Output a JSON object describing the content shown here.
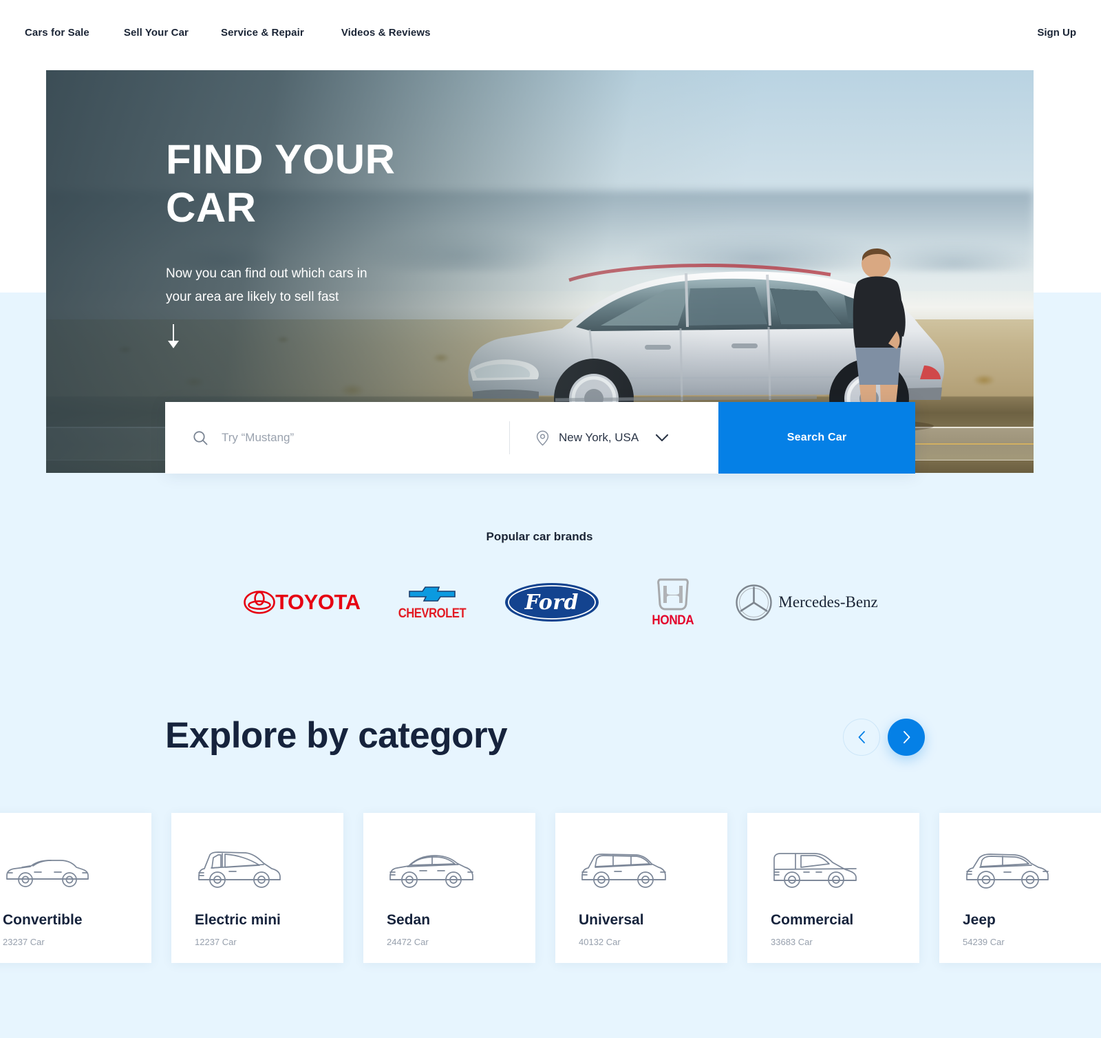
{
  "nav": {
    "links": [
      {
        "label": "Cars for Sale"
      },
      {
        "label": "Sell Your Car"
      },
      {
        "label": "Service & Repair"
      },
      {
        "label": "Videos & Reviews"
      }
    ],
    "signup_label": "Sign Up"
  },
  "hero": {
    "title": "FIND YOUR CAR",
    "subtitle": "Now you can find out which cars in your area are likely to sell fast",
    "scroll_icon": "arrow-down-icon"
  },
  "search": {
    "placeholder": "Try “Mustang”",
    "search_icon": "search-icon",
    "location_icon": "map-pin-icon",
    "location_value": "New York, USA",
    "chevron_icon": "chevron-down-icon",
    "button_label": "Search Car",
    "accent_color": "#0580e6"
  },
  "brands": {
    "title": "Popular car brands",
    "items": [
      {
        "name": "Toyota",
        "wordmark": "TOYOTA",
        "color": "#e60012"
      },
      {
        "name": "Chevrolet",
        "wordmark": "CHEVROLET",
        "color": "#e21b23"
      },
      {
        "name": "Ford",
        "wordmark": "Ford",
        "color": "#1b3f94"
      },
      {
        "name": "Honda",
        "wordmark": "HONDA",
        "color": "#e3032c"
      },
      {
        "name": "Mercedes-Benz",
        "wordmark": "Mercedes-Benz",
        "color": "#16233c"
      }
    ]
  },
  "explore": {
    "title": "Explore  by category",
    "prev_icon": "chevron-left-icon",
    "next_icon": "chevron-right-icon",
    "cards": [
      {
        "title": "Convertible",
        "count": "23237 Car",
        "icon": "convertible-car-icon"
      },
      {
        "title": "Electric mini",
        "count": "12237 Car",
        "icon": "electric-mini-car-icon"
      },
      {
        "title": "Sedan",
        "count": "24472 Car",
        "icon": "sedan-car-icon"
      },
      {
        "title": "Universal",
        "count": "40132 Car",
        "icon": "universal-wagon-icon"
      },
      {
        "title": "Commercial",
        "count": "33683 Car",
        "icon": "commercial-van-icon"
      },
      {
        "title": "Jeep",
        "count": "54239 Car",
        "icon": "jeep-suv-icon"
      }
    ]
  },
  "theme": {
    "page_background": "#e7f5fe",
    "accent": "#0580e6",
    "text_dark": "#16233c"
  }
}
